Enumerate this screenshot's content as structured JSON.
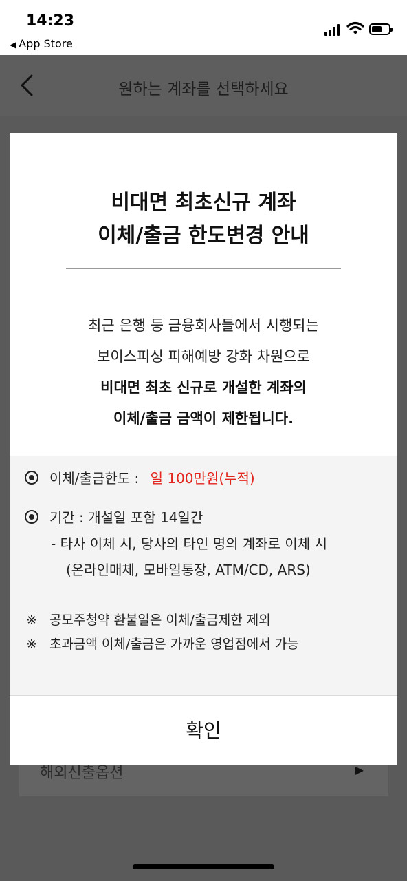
{
  "status_bar": {
    "time": "14:23",
    "back_app": "App Store"
  },
  "header": {
    "title": "원하는 계좌를 선택하세요"
  },
  "behind": {
    "row_label": "해외신출옵션"
  },
  "modal": {
    "title_line1": "비대면 최초신규 계좌",
    "title_line2": "이체/출금 한도변경 안내",
    "desc_line1": "최근 은행 등 금융회사들에서 시행되는",
    "desc_line2": "보이스피싱 피해예방 강화 차원으로",
    "desc_line3": "비대면 최초 신규로 개설한 계좌의",
    "desc_line4": "이체/출금 금액이 제한됩니다.",
    "limit_label": "이체/출금한도 :",
    "limit_value": "일 100만원(누적)",
    "period_label": "기간 : 개설일 포함 14일간",
    "period_sub1": "- 타사 이체 시, 당사의 타인 명의 계좌로 이체 시",
    "period_sub2": "(온라인매체, 모바일통장, ATM/CD, ARS)",
    "note_mark": "※",
    "note1": "공모주청약 환불일은 이체/출금제한 제외",
    "note2": "초과금액 이체/출금은 가까운 영업점에서 가능",
    "confirm_label": "확인"
  },
  "colors": {
    "accent_red": "#e3261d",
    "overlay": "#5a5a5a"
  },
  "icons": {
    "back": "chevron-left-icon",
    "radio": "radio-selected-icon",
    "signal": "cellular-signal-icon",
    "wifi": "wifi-icon",
    "battery": "battery-icon",
    "arrow": "triangle-right-icon"
  }
}
